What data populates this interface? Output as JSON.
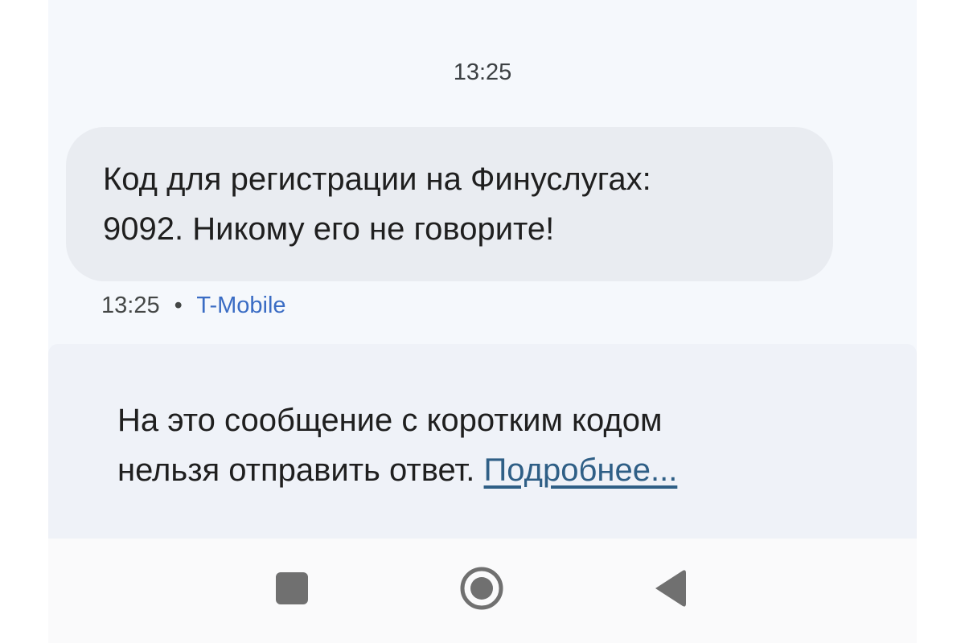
{
  "conversation": {
    "time_header": "13:25"
  },
  "message": {
    "line1": "Код для регистрации на Финуслугах:",
    "line2": "9092. Никому его не говорите!",
    "time": "13:25",
    "separator": "•",
    "carrier": "T-Mobile"
  },
  "notice": {
    "line1": "На это сообщение с коротким кодом",
    "line2_text": "нельзя отправить ответ.",
    "link": "Подробнее..."
  },
  "navbar": {
    "recent_icon": "square-icon",
    "home_icon": "circle-home-icon",
    "back_icon": "triangle-back-icon"
  },
  "colors": {
    "background": "#f5f8fc",
    "bubble": "#e9ecf1",
    "carrier_link": "#3a6cc4",
    "notice_link": "#2f5f86",
    "nav_icon": "#707070"
  }
}
